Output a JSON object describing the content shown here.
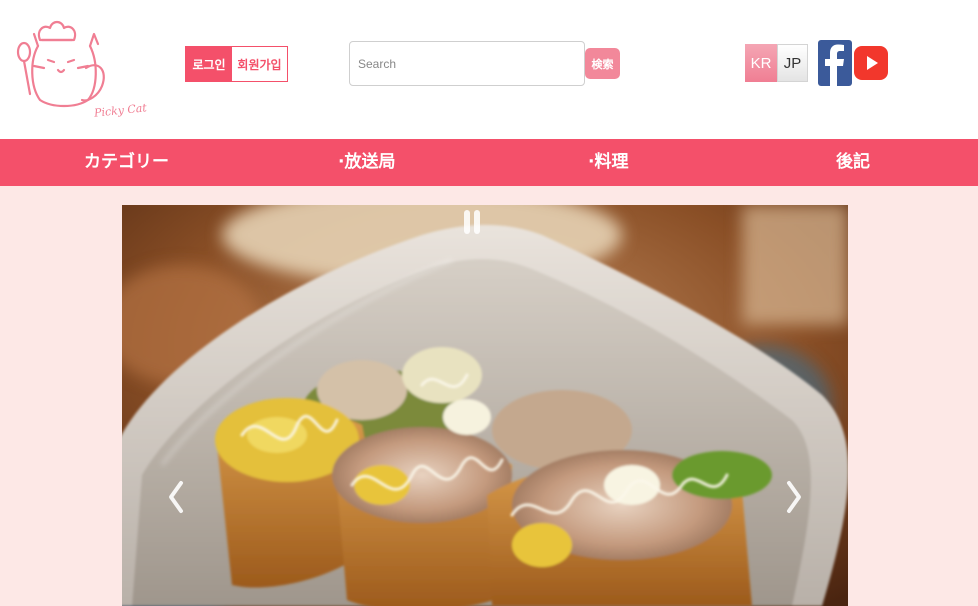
{
  "header": {
    "logo_text": "Picky Cat",
    "login_label": "로그인",
    "signup_label": "회원가입",
    "search": {
      "placeholder": "Search",
      "value": ""
    },
    "search_button_label": "検索",
    "languages": [
      "KR",
      "JP"
    ],
    "selected_language": "KR",
    "social_icons": [
      "facebook-icon",
      "youtube-icon"
    ]
  },
  "nav": {
    "items": [
      {
        "label": "カテゴリー"
      },
      {
        "label": "·放送局"
      },
      {
        "label": "·料理"
      },
      {
        "label": "後記"
      }
    ]
  },
  "carousel": {
    "controls": [
      "chevron-left-icon",
      "chevron-right-icon"
    ]
  },
  "colors": {
    "brand": "#f4506a",
    "background": "#fde8e6",
    "logo": "#f07e93",
    "facebook": "#3b5a9a",
    "youtube": "#f2372c"
  }
}
